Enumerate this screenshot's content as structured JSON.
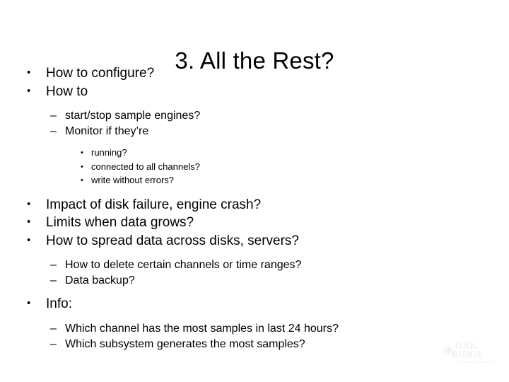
{
  "slide": {
    "title": "3. All the Rest?",
    "background_color": "#ffffff",
    "text_color": "#000000",
    "markers": {
      "level1": "•",
      "level2": "–",
      "level3": "•"
    },
    "outline": [
      {
        "level": 1,
        "text": "How to configure?"
      },
      {
        "level": 1,
        "text": "How to"
      },
      {
        "level": 2,
        "text": "start/stop sample engines?"
      },
      {
        "level": 2,
        "text": "Monitor if they’re"
      },
      {
        "level": 3,
        "text": "running?"
      },
      {
        "level": 3,
        "text": "connected to all channels?"
      },
      {
        "level": 3,
        "text": "write without errors?"
      },
      {
        "level": 1,
        "text": "Impact of disk failure, engine crash?"
      },
      {
        "level": 1,
        "text": "Limits when data grows?"
      },
      {
        "level": 1,
        "text": "How to spread data across disks, servers?"
      },
      {
        "level": 2,
        "text": "How to delete certain channels or time ranges?"
      },
      {
        "level": 2,
        "text": "Data backup?"
      },
      {
        "level": 1,
        "text": "Info:"
      },
      {
        "level": 2,
        "text": "Which channel has the most samples in last 24 hours?"
      },
      {
        "level": 2,
        "text": "Which subsystem generates the most samples?"
      }
    ]
  },
  "watermark": {
    "star_glyph": "✳",
    "line1": "OAK",
    "line2": "RIDGE",
    "line3": "National Laboratory",
    "color": "#ececec"
  }
}
